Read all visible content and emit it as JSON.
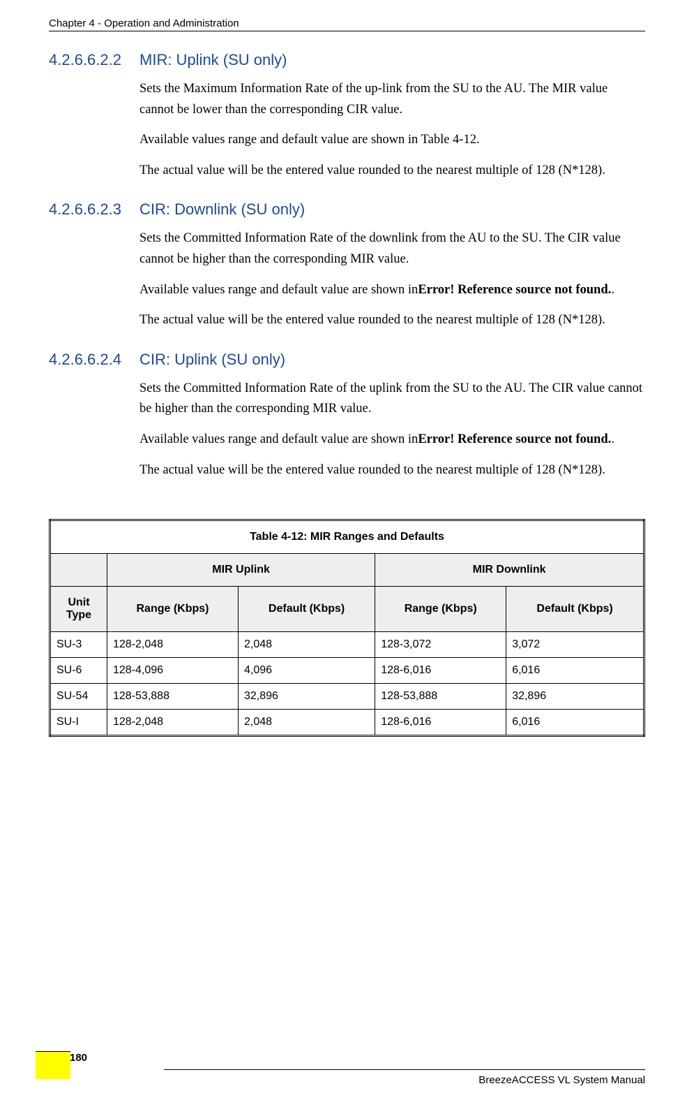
{
  "header": "Chapter 4 - Operation and Administration",
  "sections": [
    {
      "num": "4.2.6.6.2.2",
      "title": "MIR: Uplink (SU only)",
      "p1": "Sets the Maximum Information Rate of the up-link from the SU to the AU. The MIR value cannot be lower than the corresponding CIR value.",
      "p2": "Available values range and default value are shown in Table 4-12.",
      "p3": "The actual value will be the entered value rounded to the nearest multiple of 128 (N*128)."
    },
    {
      "num": "4.2.6.6.2.3",
      "title": "CIR: Downlink (SU only)",
      "p1": "Sets the Committed Information Rate of the downlink from the AU to the SU. The CIR value cannot be higher than the corresponding MIR value.",
      "p2a": "Available values range and default value are shown in",
      "p2b": "Error! Reference source not found.",
      "p2c": ".",
      "p3": "The actual value will be the entered value rounded to the nearest multiple of 128 (N*128)."
    },
    {
      "num": "4.2.6.6.2.4",
      "title": "CIR: Uplink (SU only)",
      "p1": "Sets the Committed Information Rate of the uplink from the SU to the AU. The CIR value cannot be higher than the corresponding MIR value.",
      "p2a": "Available values range and default value are shown in",
      "p2b": "Error! Reference source not found.",
      "p2c": ".",
      "p3": "The actual value will be the entered value rounded to the nearest multiple of 128 (N*128)."
    }
  ],
  "table": {
    "title": "Table 4-12: MIR Ranges and Defaults",
    "head": {
      "uplink": "MIR Uplink",
      "downlink": "MIR Downlink",
      "unit": "Unit Type",
      "range": "Range (Kbps)",
      "default": "Default (Kbps)"
    },
    "rows": [
      {
        "unit": "SU-3",
        "urange": "128-2,048",
        "udefault": "2,048",
        "drange": "128-3,072",
        "ddefault": "3,072"
      },
      {
        "unit": "SU-6",
        "urange": "128-4,096",
        "udefault": "4,096",
        "drange": "128-6,016",
        "ddefault": "6,016"
      },
      {
        "unit": "SU-54",
        "urange": "128-53,888",
        "udefault": "32,896",
        "drange": "128-53,888",
        "ddefault": "32,896"
      },
      {
        "unit": "SU-I",
        "urange": "128-2,048",
        "udefault": "2,048",
        "drange": "128-6,016",
        "ddefault": "6,016"
      }
    ]
  },
  "footer": "BreezeACCESS VL System Manual",
  "page": "180"
}
